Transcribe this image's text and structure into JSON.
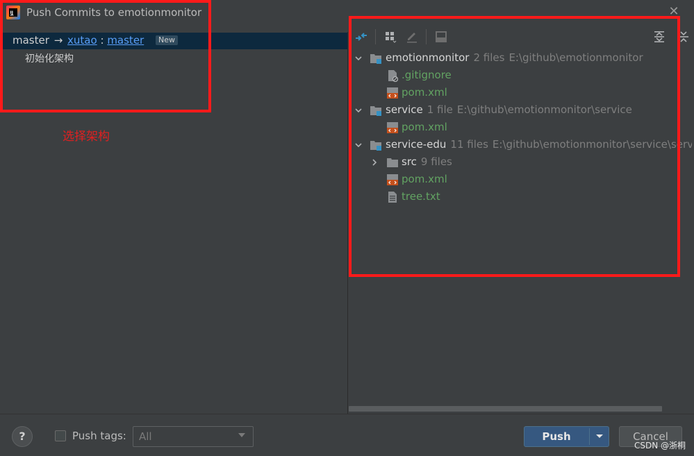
{
  "window": {
    "title": "Push Commits to emotionmonitor"
  },
  "left": {
    "branch": {
      "local": "master",
      "arrow": "→",
      "remote": "xutao",
      "separator": ":",
      "remote_branch": "master",
      "badge": "New"
    },
    "commits": [
      "初始化架构"
    ],
    "annotation": "选择架构"
  },
  "tree": [
    {
      "kind": "repo",
      "label": "emotionmonitor",
      "count": "2 files",
      "path": "E:\\github\\emotionmonitor"
    },
    {
      "kind": "file",
      "label": ".gitignore",
      "icon": "gitignore-file-icon"
    },
    {
      "kind": "file",
      "label": "pom.xml",
      "icon": "maven-file-icon"
    },
    {
      "kind": "repo",
      "label": "service",
      "count": "1 file",
      "path": "E:\\github\\emotionmonitor\\service"
    },
    {
      "kind": "file",
      "label": "pom.xml",
      "icon": "maven-file-icon"
    },
    {
      "kind": "repo",
      "label": "service-edu",
      "count": "11 files",
      "path": "E:\\github\\emotionmonitor\\service\\servic"
    },
    {
      "kind": "dir",
      "label": "src",
      "count": "9 files"
    },
    {
      "kind": "file",
      "label": "pom.xml",
      "icon": "maven-file-icon"
    },
    {
      "kind": "file",
      "label": "tree.txt",
      "icon": "text-file-icon"
    }
  ],
  "bottom": {
    "help": "?",
    "push_tags_label": "Push tags:",
    "push_tags_value": "All",
    "push_label": "Push",
    "cancel_label": "Cancel",
    "watermark": "CSDN @浙桐"
  },
  "colors": {
    "annotation": "#ff1a1a",
    "file_text": "#62a362",
    "link": "#589df6",
    "accent_button": "#365880"
  }
}
